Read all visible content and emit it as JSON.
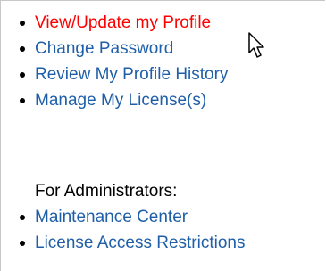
{
  "menu": {
    "items": [
      {
        "label": "View/Update my Profile",
        "state": "hover"
      },
      {
        "label": "Change Password"
      },
      {
        "label": "Review My Profile History"
      },
      {
        "label": "Manage My License(s)"
      }
    ]
  },
  "admin": {
    "heading": "For Administrators:",
    "items": [
      {
        "label": "Maintenance Center"
      },
      {
        "label": "License Access Restrictions"
      }
    ]
  },
  "colors": {
    "link": "#1f5fa8",
    "link_hover": "#ff0000",
    "bullet": "#000000",
    "border": "#c8c8c8"
  },
  "cursor": {
    "icon": "arrow-pointer-icon"
  }
}
